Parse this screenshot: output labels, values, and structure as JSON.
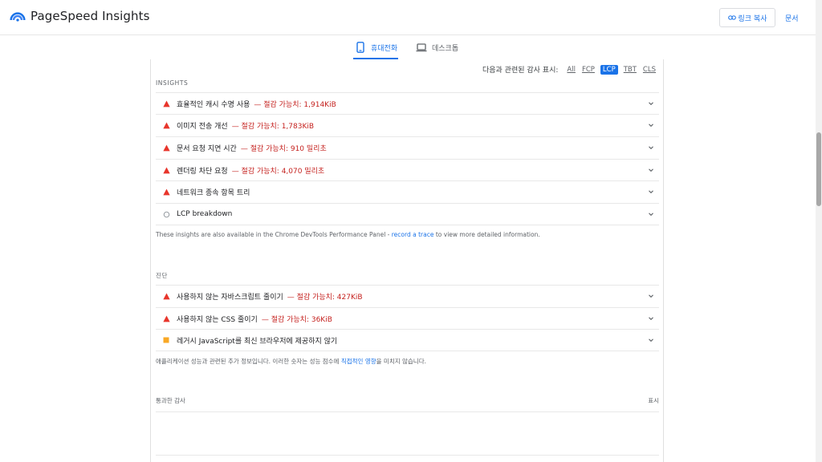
{
  "header": {
    "title": "PageSpeed Insights",
    "copy_link": "링크 복사",
    "docs": "문서"
  },
  "tabs": [
    {
      "label": "휴대전화",
      "icon": "smartphone-icon",
      "active": true
    },
    {
      "label": "데스크톱",
      "icon": "laptop-icon",
      "active": false
    }
  ],
  "filter": {
    "label": "다음과 관련된 감사 표시:",
    "options": [
      "All",
      "FCP",
      "LCP",
      "TBT",
      "CLS"
    ],
    "active": "LCP"
  },
  "insights": {
    "title": "INSIGHTS",
    "items": [
      {
        "label": "효율적인 캐시 수명 사용",
        "saving": "— 절감 가능치: 1,914KiB",
        "status": "fail"
      },
      {
        "label": "이미지 전송 개선",
        "saving": "— 절감 가능치: 1,783KiB",
        "status": "fail"
      },
      {
        "label": "문서 요청 지연 시간",
        "saving": "— 절감 가능치: 910 밀리초",
        "status": "fail"
      },
      {
        "label": "렌더링 차단 요청",
        "saving": "— 절감 가능치: 4,070 밀리초",
        "status": "fail"
      },
      {
        "label": "네트워크 종속 항목 트리",
        "saving": "",
        "status": "fail"
      },
      {
        "label": "LCP breakdown",
        "saving": "",
        "status": "info"
      }
    ],
    "note_pre": "These insights are also available in the Chrome DevTools Performance Panel - ",
    "note_link": "record a trace",
    "note_post": " to view more detailed information."
  },
  "diagnostics": {
    "title": "진단",
    "items": [
      {
        "label": "사용하지 않는 자바스크립트 줄이기",
        "saving": "— 절감 가능치: 427KiB",
        "status": "fail"
      },
      {
        "label": "사용하지 않는 CSS 줄이기",
        "saving": "— 절감 가능치: 36KiB",
        "status": "fail"
      },
      {
        "label": "레거시 JavaScript를 최신 브라우저에 제공하지 않기",
        "saving": "",
        "status": "average"
      }
    ],
    "note_pre": "애플리케이션 성능과 관련된 추가 정보입니다. 이러한 숫자는 성능 점수에 ",
    "note_link": "직접적인 영향",
    "note_post": "을 미치지 않습니다."
  },
  "passed": {
    "title": "통과한 감사",
    "show": "표시"
  },
  "colors": {
    "accent": "#1a73e8",
    "fail": "#e8352b",
    "average": "#f9a825",
    "saving": "#c5221f"
  }
}
